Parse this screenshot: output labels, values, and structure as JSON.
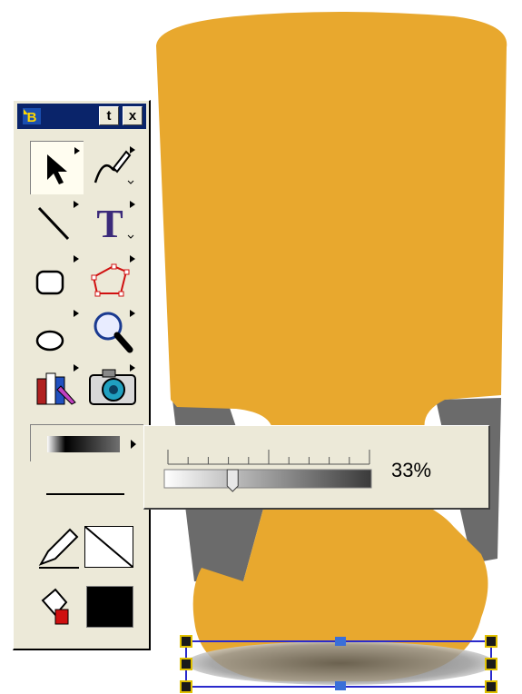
{
  "toolbox": {
    "title_buttons": {
      "restore_label": "t",
      "close_label": "x"
    },
    "tools": [
      {
        "name": "pointer-tool",
        "icon": "arrow-pointer-icon",
        "selected": true
      },
      {
        "name": "freehand-pen-tool",
        "icon": "pen-curve-icon"
      },
      {
        "name": "line-tool",
        "icon": "line-icon"
      },
      {
        "name": "text-tool",
        "icon": "text-T-icon",
        "label": "T"
      },
      {
        "name": "rounded-rectangle-tool",
        "icon": "rounded-rect-icon"
      },
      {
        "name": "polygon-tool",
        "icon": "polygon-icon"
      },
      {
        "name": "ellipse-tool",
        "icon": "ellipse-icon"
      },
      {
        "name": "zoom-tool",
        "icon": "magnifier-icon"
      },
      {
        "name": "symbol-library-tool",
        "icon": "books-icon"
      },
      {
        "name": "camera-tool",
        "icon": "camera-icon"
      },
      {
        "name": "gradient-fill-tool",
        "icon": "gradient-icon"
      }
    ],
    "stroke_color": "#000000",
    "fill_color": "#000000"
  },
  "opacity_slider": {
    "value_label": "33%",
    "value": 0.33,
    "ticks": 11
  },
  "canvas_colors": {
    "bottle_body": "#e8a82e",
    "bottle_shadow": "#6f6f6f",
    "selection": "#2a2acc",
    "handle": "#3a6fd8"
  }
}
